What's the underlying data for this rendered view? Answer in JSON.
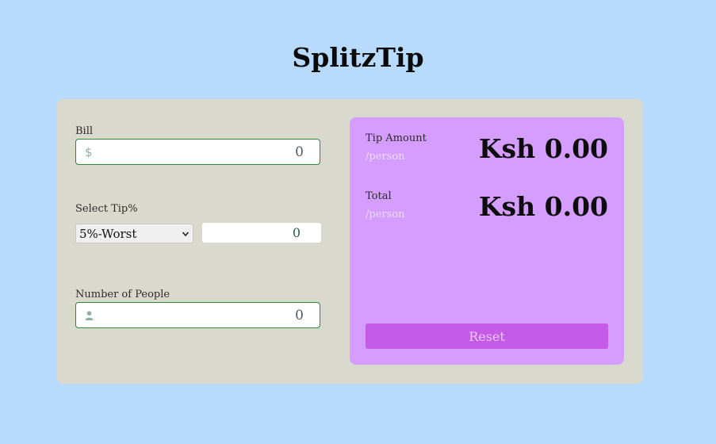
{
  "app_title": "SplitzTip",
  "colors": {
    "background": "#b8dafd",
    "card": "#d9d9cd",
    "result_panel": "#d59dfd",
    "reset_button": "#c65ae8",
    "input_border": "#2e8b3a"
  },
  "form": {
    "bill": {
      "label": "Bill",
      "icon": "dollar-icon",
      "icon_glyph": "$",
      "value": "0"
    },
    "tip": {
      "label": "Select Tip%",
      "selected": "5%-Worst",
      "custom_value": "0"
    },
    "people": {
      "label": "Number of People",
      "icon": "person-icon",
      "value": "0"
    }
  },
  "results": {
    "tip_amount": {
      "label": "Tip Amount",
      "sub": "/person",
      "value": "Ksh 0.00"
    },
    "total": {
      "label": "Total",
      "sub": "/person",
      "value": "Ksh 0.00"
    },
    "reset_label": "Reset"
  }
}
